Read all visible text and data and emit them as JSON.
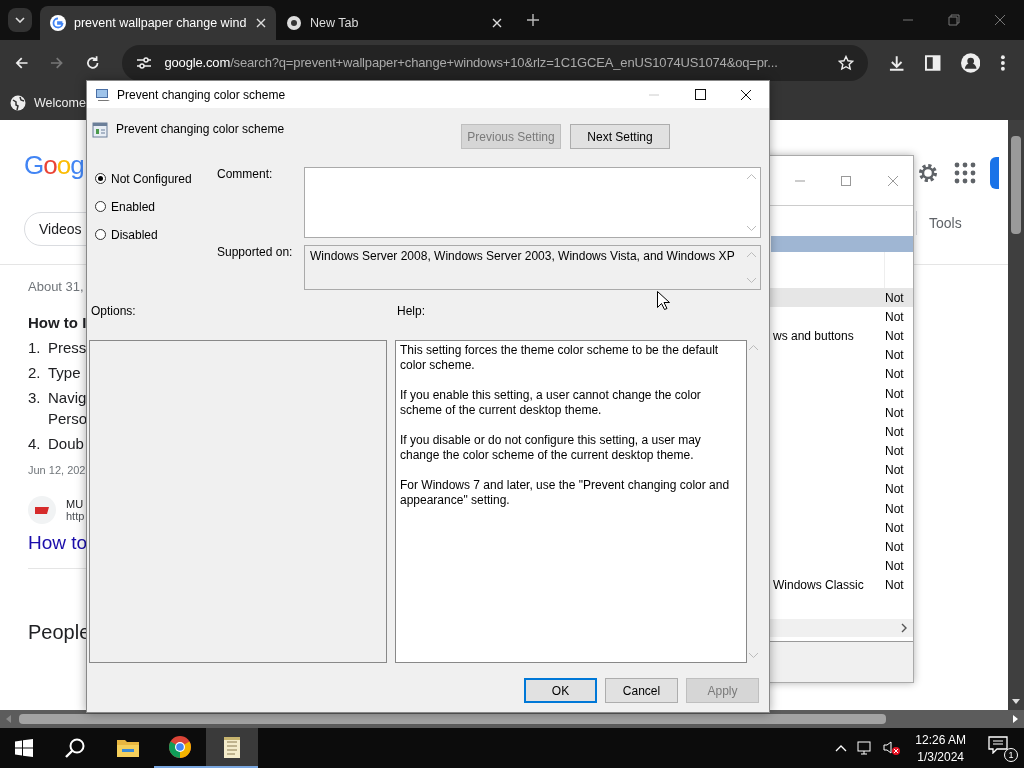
{
  "browser": {
    "tabs": [
      {
        "title": "prevent wallpaper change wind",
        "kind": "google",
        "selected": true
      },
      {
        "title": "New Tab",
        "kind": "chrome",
        "selected": false
      }
    ],
    "url_host": "google.com",
    "url_rest": "/search?q=prevent+wallpaper+change+windows+10&rlz=1C1GCEA_enUS1074US1074&oq=pr...",
    "bookmarks": [
      "Welcome"
    ]
  },
  "google_page": {
    "logo_text": "Goog",
    "filter_chip": "Videos",
    "tools": "Tools",
    "result_count": "About 31,",
    "snippet_title": "How to I",
    "steps": [
      {
        "number": "1.",
        "lines": [
          "Press"
        ]
      },
      {
        "number": "2.",
        "lines": [
          "Type"
        ]
      },
      {
        "number": "3.",
        "lines": [
          "Navig",
          "Perso"
        ]
      },
      {
        "number": "4.",
        "lines": [
          "Doub"
        ]
      }
    ],
    "date": "Jun 12, 202",
    "source_name": "MU",
    "source_url": "http",
    "result_title": "How to",
    "people_heading": "People"
  },
  "background_window": {
    "rows": [
      {
        "state": "Not",
        "selected": true
      },
      {
        "state": "Not",
        "selected": false
      },
      {
        "name": "ws and buttons",
        "state": "Not",
        "selected": false
      },
      {
        "state": "Not",
        "selected": false
      },
      {
        "state": "Not",
        "selected": false
      },
      {
        "state": "Not",
        "selected": false
      },
      {
        "state": "Not",
        "selected": false
      },
      {
        "state": "Not",
        "selected": false
      },
      {
        "state": "Not",
        "selected": false
      },
      {
        "state": "Not",
        "selected": false
      },
      {
        "state": "Not",
        "selected": false
      },
      {
        "state": "Not",
        "selected": false
      },
      {
        "state": "Not",
        "selected": false
      },
      {
        "state": "Not",
        "selected": false
      },
      {
        "state": "Not",
        "selected": false
      },
      {
        "name": "Windows Classic",
        "state": "Not",
        "selected": false
      }
    ]
  },
  "dialog": {
    "title": "Prevent changing color scheme",
    "policy_name": "Prevent changing color scheme",
    "nav_buttons": [
      {
        "label": "Previous Setting",
        "disabled": true
      },
      {
        "label": "Next Setting",
        "disabled": false
      }
    ],
    "options": [
      {
        "label": "Not Configured",
        "selected": true
      },
      {
        "label": "Enabled",
        "selected": false
      },
      {
        "label": "Disabled",
        "selected": false
      }
    ],
    "comment_label": "Comment:",
    "supported_label": "Supported on:",
    "supported_value": "Windows Server 2008, Windows Server 2003, Windows Vista, and Windows XP",
    "options_label": "Options:",
    "help_label": "Help:",
    "help_paragraphs": [
      "This setting forces the theme color scheme to be the default color scheme.",
      "If you enable this setting, a user cannot change the color scheme of the current desktop theme.",
      "If you disable or do not configure this setting, a user may change the color scheme of the current desktop theme.",
      "For Windows 7 and later, use the \"Prevent changing color and appearance\" setting."
    ],
    "footer_buttons": [
      {
        "label": "OK",
        "disabled": false,
        "default": true
      },
      {
        "label": "Cancel",
        "disabled": false,
        "default": false
      },
      {
        "label": "Apply",
        "disabled": true,
        "default": false
      }
    ]
  },
  "taskbar": {
    "apps": [
      {
        "kind": "explorer",
        "running": false,
        "selected": false
      },
      {
        "kind": "chrome",
        "running": true,
        "selected": false
      },
      {
        "kind": "notepad",
        "running": true,
        "selected": true
      }
    ],
    "time": "12:26 AM",
    "date": "1/3/2024",
    "notification_count": "1"
  }
}
